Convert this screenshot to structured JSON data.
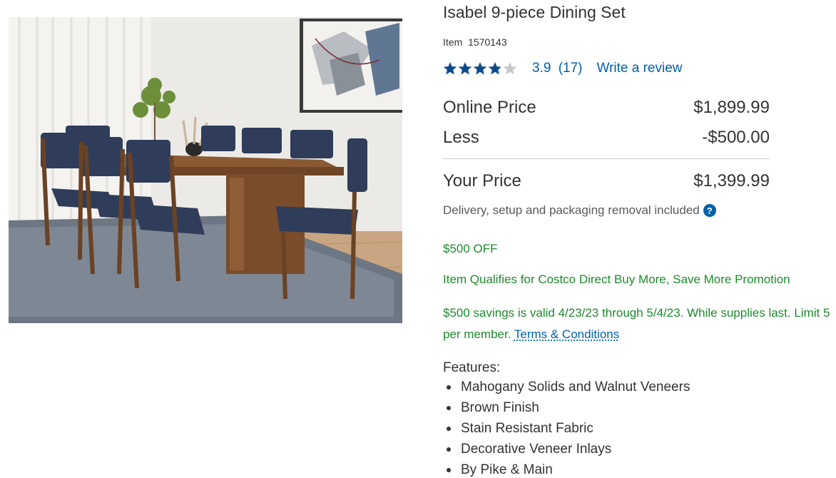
{
  "product": {
    "title": "Isabel 9-piece Dining Set",
    "item_label": "Item",
    "item_number": "1570143",
    "image_alt": "Isabel 9-piece dining set with walnut table and navy upholstered chairs"
  },
  "rating": {
    "stars_value": 3.9,
    "stars_max": 5,
    "score": "3.9",
    "count": "(17)",
    "write_review": "Write a review",
    "star_color": "#0b4a8b",
    "star_empty_color": "#c8c8c8"
  },
  "pricing": {
    "online_label": "Online Price",
    "online_value": "$1,899.99",
    "less_label": "Less",
    "less_value": "-$500.00",
    "your_label": "Your Price",
    "your_value": "$1,399.99",
    "delivery_note": "Delivery, setup and packaging removal included",
    "help_icon_glyph": "?"
  },
  "promotion": {
    "off_text": "$500 OFF",
    "qualifies_text": "Item Qualifies for Costco Direct Buy More, Save More Promotion",
    "valid_text": "$500 savings is valid 4/23/23 through 5/4/23. While supplies last. Limit 5 per member.",
    "terms_link": "Terms & Conditions",
    "color": "#1f8a2e"
  },
  "features": {
    "heading": "Features:",
    "items": [
      "Mahogany Solids and Walnut Veneers",
      "Brown Finish",
      "Stain Resistant Fabric",
      "Decorative Veneer Inlays",
      "By Pike & Main"
    ]
  },
  "colors": {
    "link": "#0060a9",
    "text": "#333333",
    "muted": "#5a5a5a"
  }
}
